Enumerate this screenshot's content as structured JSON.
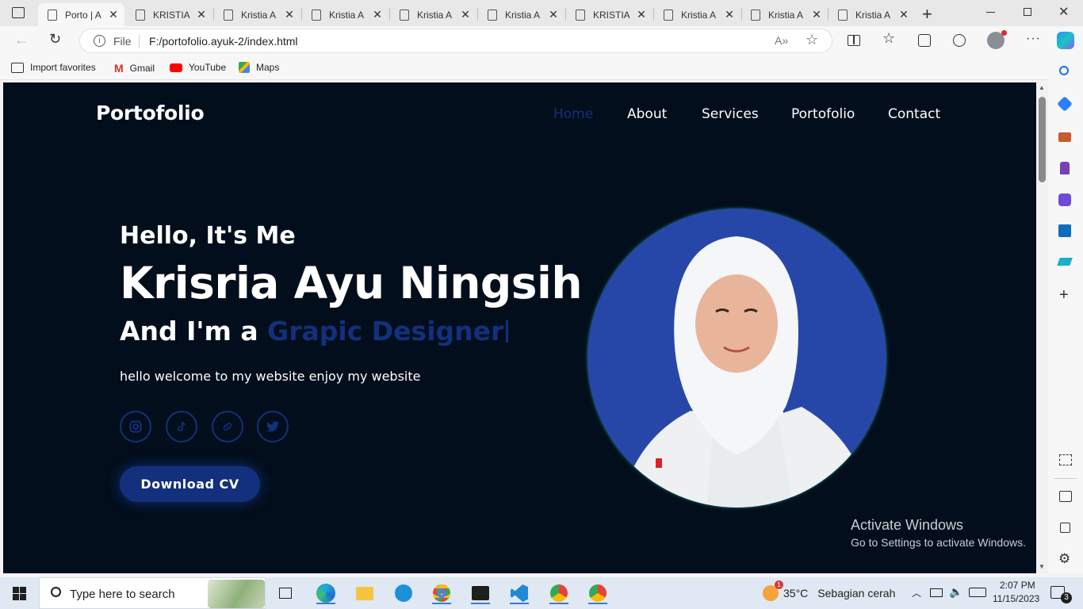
{
  "browser": {
    "tabs": [
      {
        "title": "Porto | A",
        "active": true
      },
      {
        "title": "KRISTIA"
      },
      {
        "title": "Kristia A"
      },
      {
        "title": "Kristia A"
      },
      {
        "title": "Kristia A"
      },
      {
        "title": "Kristia A"
      },
      {
        "title": "KRISTIA"
      },
      {
        "title": "Kristia A"
      },
      {
        "title": "Kristia A"
      },
      {
        "title": "Kristia A"
      }
    ],
    "address_prefix": "File",
    "url": "F:/portofolio.ayuk-2/index.html",
    "favorites": [
      "Import favorites",
      "Gmail",
      "YouTube",
      "Maps"
    ]
  },
  "site": {
    "logo": "Portofolio",
    "nav": [
      "Home",
      "About",
      "Services",
      "Portofolio",
      "Contact"
    ],
    "active_nav": "Home",
    "greeting": "Hello, It's Me",
    "name": "Krisria Ayu Ningsih",
    "role_prefix": "And I'm a ",
    "role": "Grapic Designer",
    "lead": "hello welcome to my website enjoy my website",
    "socials": [
      "instagram-icon",
      "tiktok-icon",
      "link-icon",
      "twitter-icon"
    ],
    "cta": "Download CV",
    "accent": "#13307c"
  },
  "watermark": {
    "line1": "Activate Windows",
    "line2": "Go to Settings to activate Windows."
  },
  "taskbar": {
    "search_placeholder": "Type here to search",
    "weather_temp": "35°C",
    "weather_text": "Sebagian cerah",
    "time": "2:07 PM",
    "date": "11/15/2023",
    "notifications": "3",
    "weather_badge": "1"
  }
}
